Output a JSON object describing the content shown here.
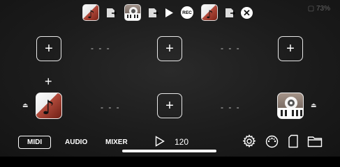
{
  "status": {
    "battery": "73%"
  },
  "top_strip": {
    "apps": [
      {
        "name": "music-app",
        "icon": "music-note-app-icon"
      },
      {
        "name": "piano-app",
        "icon": "piano-app-icon"
      },
      {
        "name": "music-app-2",
        "icon": "music-note-app-icon"
      }
    ],
    "rec_label": "REC",
    "close_symbol": "✕"
  },
  "grid": {
    "plus_symbol": "+",
    "dashes": "- - -"
  },
  "bottom_bar": {
    "tabs": [
      "MIDI",
      "AUDIO",
      "MIXER"
    ],
    "active_tab": "MIDI",
    "tempo": "120"
  },
  "colors": {
    "background": "#1e1e1e",
    "accent": "#ffffff",
    "music_red": "#8a2a1e"
  }
}
